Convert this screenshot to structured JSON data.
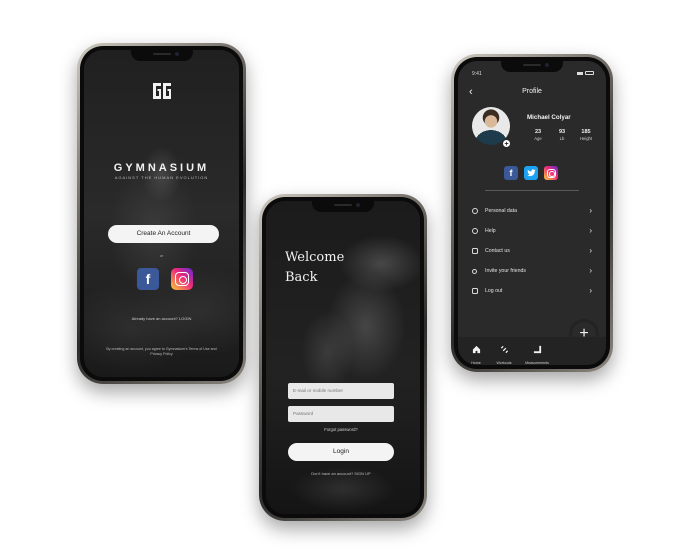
{
  "phone_login_start": {
    "brand_title": "GYMNASIUM",
    "brand_tagline": "AGAINST THE HUMAN EVOLUTION",
    "create_button": "Create An Account",
    "or_label": "or",
    "social": [
      "facebook-icon",
      "instagram-icon"
    ],
    "already_text": "Already have an account? LOGIN",
    "terms_text": "By creating an account, you agree to Gymnasium's Terms of Use and Privacy Policy"
  },
  "phone_login": {
    "welcome_line1": "Welcome",
    "welcome_line2": "Back",
    "email_placeholder": "E-mail or mobile number",
    "password_placeholder": "Password",
    "forgot_label": "Forgot password?",
    "login_button": "Login",
    "no_account_text": "Don't have an account? SIGN UP"
  },
  "phone_profile": {
    "status_time": "9:41",
    "title": "Profile",
    "user_name": "Michael Colyar",
    "stats": [
      {
        "value": "23",
        "label": "Age"
      },
      {
        "value": "93",
        "label": "Lb"
      },
      {
        "value": "185",
        "label": "Height"
      }
    ],
    "social": [
      "facebook-icon",
      "twitter-icon",
      "instagram-icon"
    ],
    "menu": [
      {
        "label": "Personal data",
        "icon": "user-icon"
      },
      {
        "label": "Help",
        "icon": "help-icon"
      },
      {
        "label": "Contact us",
        "icon": "mail-icon"
      },
      {
        "label": "Invite your friends",
        "icon": "share-icon"
      },
      {
        "label": "Log out",
        "icon": "logout-icon"
      }
    ],
    "tabs": [
      {
        "label": "Home",
        "icon": "home-icon"
      },
      {
        "label": "Workouts",
        "icon": "dumbbell-icon"
      },
      {
        "label": "Measurements",
        "icon": "chart-icon"
      }
    ],
    "fab_label": "+"
  },
  "colors": {
    "screen_dark": "#1c1c1c",
    "profile_bg": "#2a2a2a",
    "button_light": "#f4f4f4",
    "facebook": "#3b5998",
    "twitter": "#1da1f2"
  }
}
